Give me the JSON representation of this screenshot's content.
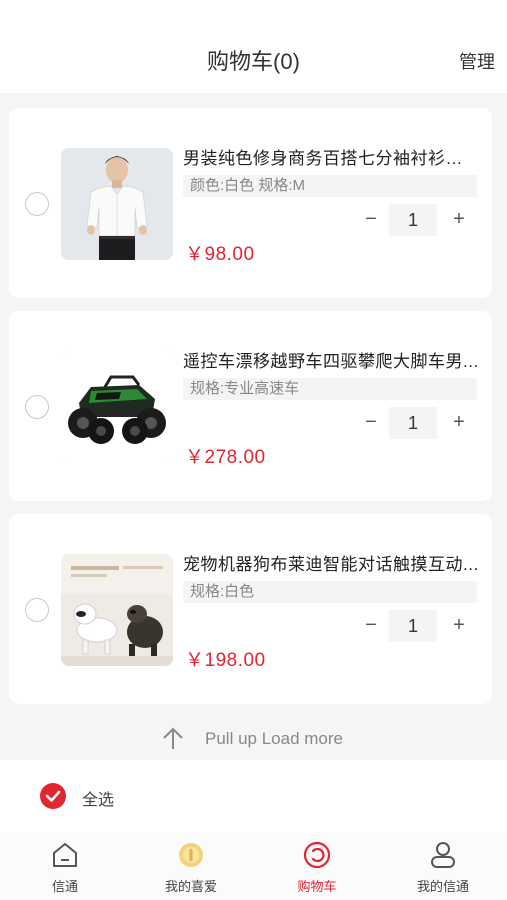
{
  "header": {
    "title": "购物车(0)",
    "manage": "管理"
  },
  "items": [
    {
      "name": "男装纯色修身商务百搭七分袖衬衫衣男",
      "spec": "颜色:白色 规格:M",
      "qty": "1",
      "price": "￥98.00",
      "minus": "−",
      "plus": "+",
      "image": "shirt-model-photo"
    },
    {
      "name": "遥控车漂移越野车四驱攀爬大脚车男...",
      "spec": "规格:专业高速车",
      "qty": "1",
      "price": "￥278.00",
      "minus": "−",
      "plus": "+",
      "image": "rc-car-photo"
    },
    {
      "name": "宠物机器狗布莱迪智能对话触摸互动...",
      "spec": "规格:白色",
      "qty": "1",
      "price": "￥198.00",
      "minus": "−",
      "plus": "+",
      "image": "robot-dog-photo"
    }
  ],
  "load_more": "Pull up Load more",
  "select_all": "全选",
  "tabs": [
    {
      "label": "信通",
      "icon": "home-icon",
      "active": false
    },
    {
      "label": "我的喜爱",
      "icon": "favorite-coin-icon",
      "active": false
    },
    {
      "label": "购物车",
      "icon": "cart-icon",
      "active": true
    },
    {
      "label": "我的信通",
      "icon": "user-icon",
      "active": false
    }
  ],
  "colors": {
    "accent": "#e2252f",
    "background": "#f5f5f5",
    "card": "#ffffff",
    "spec_bg": "#f4f4f4"
  }
}
